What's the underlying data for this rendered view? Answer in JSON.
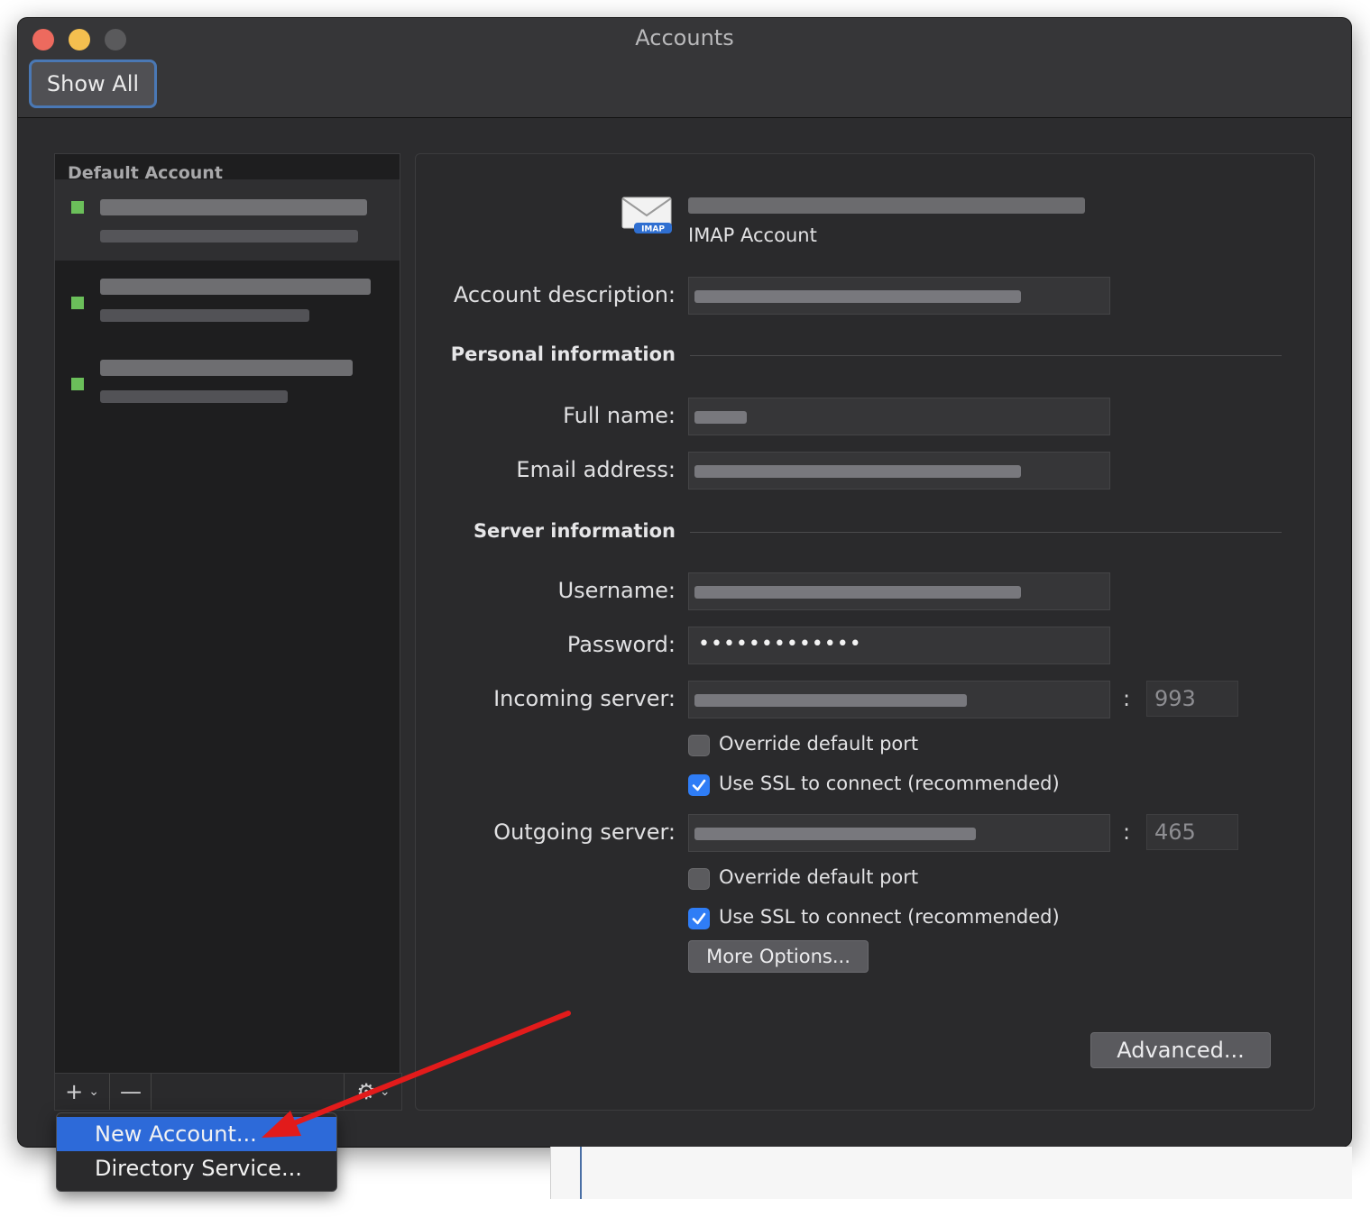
{
  "window": {
    "title": "Accounts",
    "show_all": "Show All"
  },
  "sidebar": {
    "header": "Default Account",
    "accounts": [
      {
        "status_color": "#6bbf5a",
        "selected": true
      },
      {
        "status_color": "#6bbf5a",
        "selected": false
      },
      {
        "status_color": "#6bbf5a",
        "selected": false
      }
    ],
    "add_symbol": "+",
    "remove_symbol": "—"
  },
  "detail": {
    "account_type": "IMAP Account",
    "icon_badge": "IMAP",
    "labels": {
      "description": "Account description:",
      "personal_section": "Personal information",
      "full_name": "Full name:",
      "email": "Email address:",
      "server_section": "Server information",
      "username": "Username:",
      "password": "Password:",
      "incoming": "Incoming server:",
      "outgoing": "Outgoing server:"
    },
    "password_mask": "•••••••••••••",
    "incoming_port": "993",
    "outgoing_port": "465",
    "colon": ":",
    "incoming_override": {
      "label": "Override default port",
      "checked": false
    },
    "incoming_ssl": {
      "label": "Use SSL to connect (recommended)",
      "checked": true
    },
    "outgoing_override": {
      "label": "Override default port",
      "checked": false
    },
    "outgoing_ssl": {
      "label": "Use SSL to connect (recommended)",
      "checked": true
    },
    "more_options": "More Options...",
    "advanced": "Advanced..."
  },
  "add_menu": {
    "items": [
      "New Account...",
      "Directory Service..."
    ]
  },
  "colors": {
    "accent": "#2f7df6",
    "menu_highlight": "#2d6ad9",
    "annotation_arrow": "#e21b1b"
  }
}
